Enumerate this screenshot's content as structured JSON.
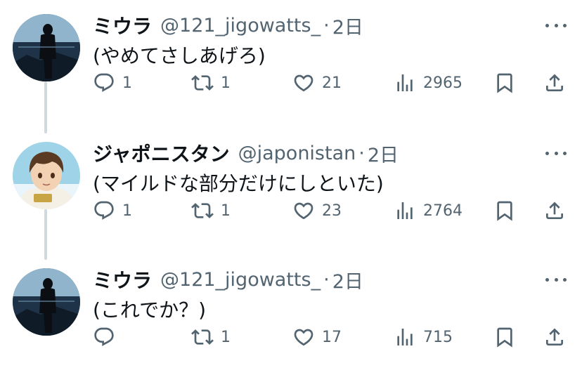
{
  "tweets": [
    {
      "display_name": "ミウラ",
      "handle": "@121_jigowatts_",
      "separator": "·",
      "time": "2日",
      "text": "(やめてさしあげろ)",
      "replies": "1",
      "retweets": "1",
      "likes": "21",
      "views": "2965",
      "avatar": "dark-silhouette-avatar"
    },
    {
      "display_name": "ジャポニスタン",
      "handle": "@japonistan",
      "separator": "·",
      "time": "2日",
      "text": "(マイルドな部分だけにしといた)",
      "replies": "1",
      "retweets": "1",
      "likes": "23",
      "views": "2764",
      "avatar": "anime-boy-avatar"
    },
    {
      "display_name": "ミウラ",
      "handle": "@121_jigowatts_",
      "separator": "·",
      "time": "2日",
      "text": "(これでか？)",
      "replies": "",
      "retweets": "1",
      "likes": "17",
      "views": "715",
      "avatar": "dark-silhouette-avatar"
    }
  ],
  "colors": {
    "text_primary": "#0f1419",
    "text_secondary": "#536471",
    "thread_line": "#cfd9de"
  },
  "icons": [
    "reply-icon",
    "retweet-icon",
    "like-icon",
    "views-icon",
    "bookmark-icon",
    "share-icon",
    "more-icon"
  ]
}
